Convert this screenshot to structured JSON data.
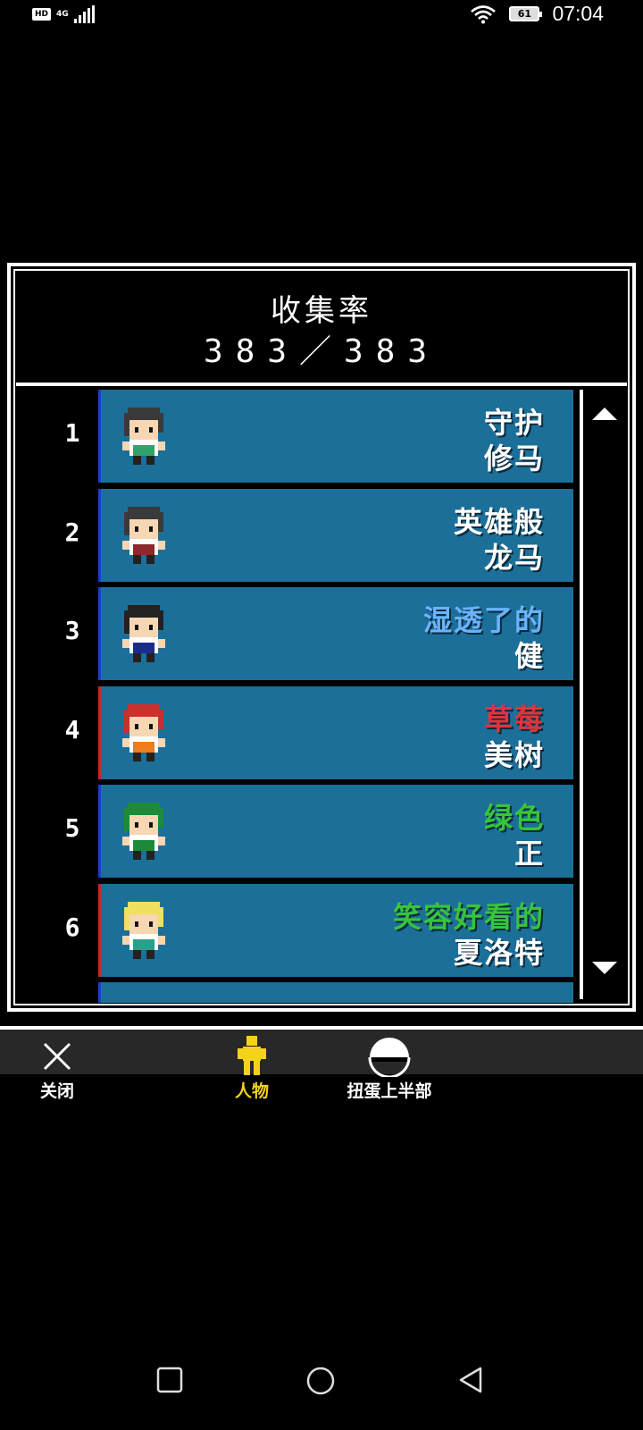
{
  "status_bar": {
    "hd": "HD",
    "network": "4G",
    "battery": "61",
    "time": "07:04"
  },
  "panel": {
    "title": "收集率",
    "count": "383／383"
  },
  "characters": [
    {
      "number": "1",
      "line1": "守护",
      "line2": "修马",
      "line1_color": "#ffffff",
      "line2_color": "#ffffff",
      "border": "blue",
      "hair": "#3a3a3a",
      "outfit": "#2fa36b"
    },
    {
      "number": "2",
      "line1": "英雄般",
      "line2": "龙马",
      "line1_color": "#ffffff",
      "line2_color": "#ffffff",
      "border": "blue",
      "hair": "#3a3a3a",
      "outfit": "#8a2a2a"
    },
    {
      "number": "3",
      "line1": "湿透了的",
      "line2": "健",
      "line1_color": "#6ab4ff",
      "line2_color": "#ffffff",
      "border": "blue",
      "hair": "#222222",
      "outfit": "#1c2c8a"
    },
    {
      "number": "4",
      "line1": "草莓",
      "line2": "美树",
      "line1_color": "#e0353b",
      "line2_color": "#ffffff",
      "border": "red",
      "hair": "#c8302c",
      "outfit": "#ee7d1d"
    },
    {
      "number": "5",
      "line1": "绿色",
      "line2": "正",
      "line1_color": "#38c43c",
      "line2_color": "#ffffff",
      "border": "blue",
      "hair": "#1d8a3a",
      "outfit": "#1d8a3a"
    },
    {
      "number": "6",
      "line1": "笑容好看的",
      "line2": "夏洛特",
      "line1_color": "#38c43c",
      "line2_color": "#ffffff",
      "border": "red",
      "hair": "#f0e060",
      "outfit": "#2aa08a"
    }
  ],
  "toolbar": {
    "close_label": "关闭",
    "characters_label": "人物",
    "egg_label": "扭蛋上半部"
  },
  "colors": {
    "card_bg": "#1c6f99",
    "active_tab": "#f4d21c",
    "border_blue": "#1a40c8",
    "border_red": "#c0282e"
  }
}
